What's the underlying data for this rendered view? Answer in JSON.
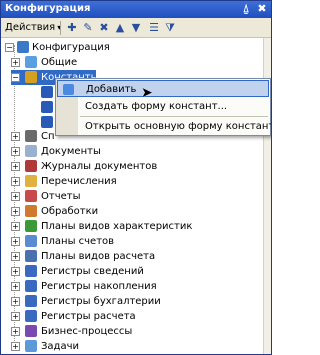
{
  "window": {
    "title": "Конфигурация",
    "pin_glyph": "⍙",
    "close_glyph": "✖"
  },
  "toolbar": {
    "actions_label": "Действия",
    "actions_arrow": "▾",
    "icons": [
      "add-icon",
      "edit-icon",
      "delete-icon",
      "move-up-icon",
      "move-down-icon",
      "sort-icon",
      "filter-icon"
    ]
  },
  "tree": {
    "items": [
      {
        "label": "Конфигурация"
      },
      {
        "label": "Общие"
      },
      {
        "label": "Константы"
      },
      {
        "label": "Сп"
      },
      {
        "label": "Документы"
      },
      {
        "label": "Журналы документов"
      },
      {
        "label": "Перечисления"
      },
      {
        "label": "Отчеты"
      },
      {
        "label": "Обработки"
      },
      {
        "label": "Планы видов характеристик"
      },
      {
        "label": "Планы счетов"
      },
      {
        "label": "Планы видов расчета"
      },
      {
        "label": "Регистры сведений"
      },
      {
        "label": "Регистры накопления"
      },
      {
        "label": "Регистры бухгалтерии"
      },
      {
        "label": "Регистры расчета"
      },
      {
        "label": "Бизнес-процессы"
      },
      {
        "label": "Задачи"
      }
    ]
  },
  "context_menu": {
    "items": [
      {
        "label": "Добавить"
      },
      {
        "label": "Создать форму констант..."
      },
      {
        "label": "Открыть основную форму констант"
      }
    ]
  }
}
